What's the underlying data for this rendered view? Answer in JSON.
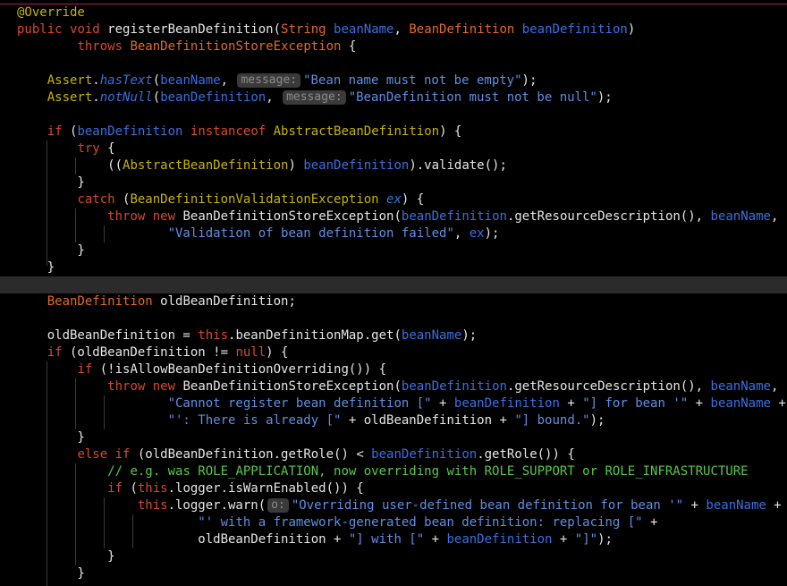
{
  "colors": {
    "background": "#000000",
    "keyword": "#d9482b",
    "type": "#e26a24",
    "parameter": "#3a6fe0",
    "string": "#5f8fe4",
    "annotation": "#c8b400",
    "comment": "#58c84b",
    "plain": "#e6e6e6",
    "hint_bg": "#3a3a3a"
  },
  "code": {
    "l1": {
      "t0": "@Override"
    },
    "l2": {
      "t0": "public",
      "t1": " ",
      "t2": "void",
      "t3": " registerBeanDefinition(",
      "t4": "String",
      "t5": " ",
      "t6": "beanName",
      "t7": ", ",
      "t8": "BeanDefinition",
      "t9": " ",
      "t10": "beanDefinition",
      "t11": ")"
    },
    "l3": {
      "t0": "        ",
      "t1": "throws",
      "t2": " ",
      "t3": "BeanDefinitionStoreException",
      "t4": " {"
    },
    "l4": {},
    "l5": {
      "t0": "    ",
      "t1": "Assert",
      "t2": ".",
      "t3": "hasText",
      "t4": "(",
      "t5": "beanName",
      "t6": ", ",
      "hint": "message:",
      "t7": "\"Bean name must not be empty\"",
      "t8": ");"
    },
    "l6": {
      "t0": "    ",
      "t1": "Assert",
      "t2": ".",
      "t3": "notNull",
      "t4": "(",
      "t5": "beanDefinition",
      "t6": ", ",
      "hint": "message:",
      "t7": "\"BeanDefinition must not be null\"",
      "t8": ");"
    },
    "l7": {},
    "l8": {
      "t0": "    ",
      "t1": "if",
      "t2": " (",
      "t3": "beanDefinition",
      "t4": " ",
      "t5": "instanceof",
      "t6": " ",
      "t7": "AbstractBeanDefinition",
      "t8": ") {"
    },
    "l9": {
      "t0": "        ",
      "t1": "try",
      "t2": " {"
    },
    "l10": {
      "t0": "            ((",
      "t1": "AbstractBeanDefinition",
      "t2": ") ",
      "t3": "beanDefinition",
      "t4": ").validate();"
    },
    "l11": {
      "t0": "        }"
    },
    "l12": {
      "t0": "        ",
      "t1": "catch",
      "t2": " (",
      "t3": "BeanDefinitionValidationException",
      "t4": " ",
      "t5": "ex",
      "t6": ") {"
    },
    "l13": {
      "t0": "            ",
      "t1": "throw",
      "t2": " ",
      "t3": "new",
      "t4": " BeanDefinitionStoreException(",
      "t5": "beanDefinition",
      "t6": ".getResourceDescription(), ",
      "t7": "beanName",
      "t8": ","
    },
    "l14": {
      "t0": "                    ",
      "t1": "\"Validation of bean definition failed\"",
      "t2": ", ",
      "t3": "ex",
      "t4": ");"
    },
    "l15": {
      "t0": "        }"
    },
    "l16": {
      "t0": "    }"
    },
    "l17": {},
    "l18": {
      "t0": "    ",
      "t1": "BeanDefinition",
      "t2": " oldBeanDefinition;"
    },
    "l19": {},
    "l20": {
      "t0": "    oldBeanDefinition = ",
      "t1": "this",
      "t2": ".beanDefinitionMap.get(",
      "t3": "beanName",
      "t4": ");"
    },
    "l21": {
      "t0": "    ",
      "t1": "if",
      "t2": " (oldBeanDefinition != ",
      "t3": "null",
      "t4": ") {"
    },
    "l22": {
      "t0": "        ",
      "t1": "if",
      "t2": " (!isAllowBeanDefinitionOverriding()) {"
    },
    "l23": {
      "t0": "            ",
      "t1": "throw",
      "t2": " ",
      "t3": "new",
      "t4": " BeanDefinitionStoreException(",
      "t5": "beanDefinition",
      "t6": ".getResourceDescription(), ",
      "t7": "beanName",
      "t8": ","
    },
    "l24": {
      "t0": "                    ",
      "t1": "\"Cannot register bean definition [\"",
      "t2": " + ",
      "t3": "beanDefinition",
      "t4": " + ",
      "t5": "\"] for bean '\"",
      "t6": " + ",
      "t7": "beanName",
      "t8": " +"
    },
    "l25": {
      "t0": "                    ",
      "t1": "\"': There is already [\"",
      "t2": " + oldBeanDefinition + ",
      "t3": "\"] bound.\"",
      "t4": ");"
    },
    "l26": {
      "t0": "        }"
    },
    "l27": {
      "t0": "        ",
      "t1": "else",
      "t2": " ",
      "t3": "if",
      "t4": " (oldBeanDefinition.getRole() < ",
      "t5": "beanDefinition",
      "t6": ".getRole()) {"
    },
    "l28": {
      "t0": "            ",
      "t1": "// e.g. was ROLE_APPLICATION, now overriding with ROLE_SUPPORT or ROLE_INFRASTRUCTURE"
    },
    "l29": {
      "t0": "            ",
      "t1": "if",
      "t2": " (",
      "t3": "this",
      "t4": ".logger.isWarnEnabled()) {"
    },
    "l30": {
      "t0": "                ",
      "t1": "this",
      "t2": ".logger.warn(",
      "hint": "o:",
      "t3": "\"Overriding user-defined bean definition for bean '\"",
      "t4": " + ",
      "t5": "beanName",
      "t6": " +"
    },
    "l31": {
      "t0": "                        ",
      "t1": "\"' with a framework-generated bean definition: replacing [\"",
      "t2": " +"
    },
    "l32": {
      "t0": "                        oldBeanDefinition + ",
      "t1": "\"] with [\"",
      "t2": " + ",
      "t3": "beanDefinition",
      "t4": " + ",
      "t5": "\"]\"",
      "t6": ");"
    },
    "l33": {
      "t0": "            }"
    },
    "l34": {
      "t0": "        }"
    }
  }
}
